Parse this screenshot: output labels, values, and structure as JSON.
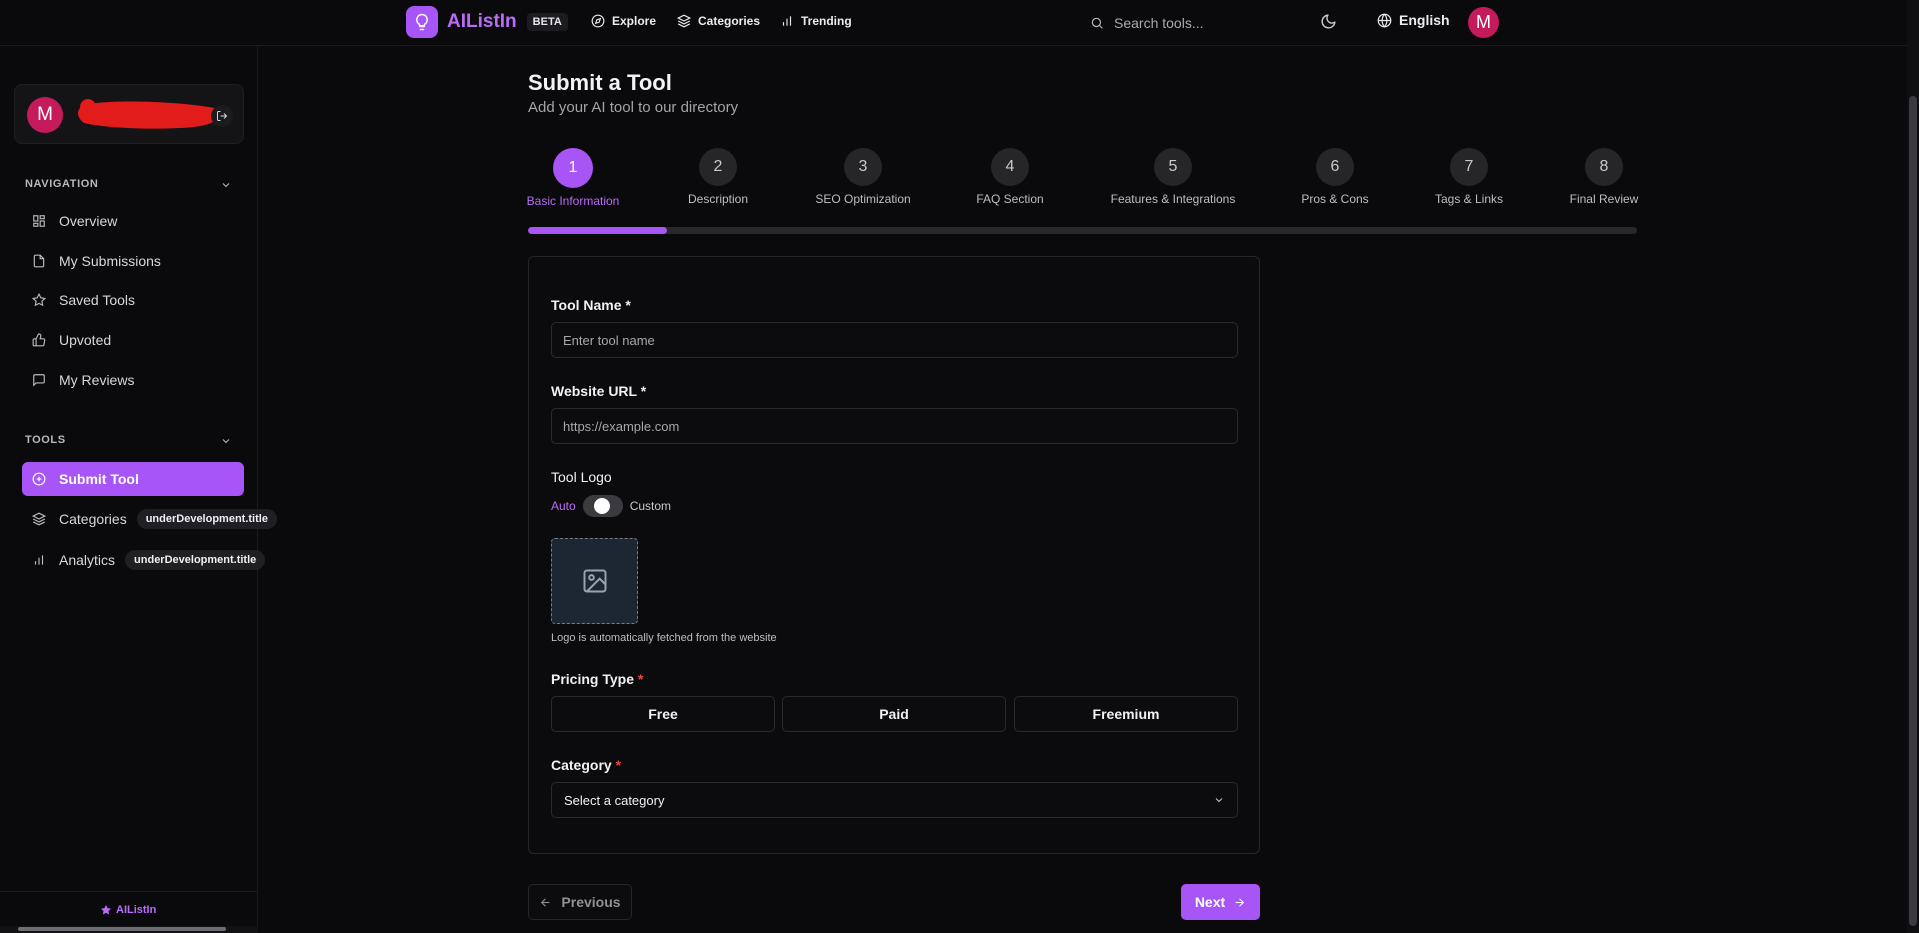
{
  "header": {
    "brand": "AIListIn",
    "beta": "BETA",
    "nav": [
      {
        "label": "Explore",
        "icon": "compass-icon"
      },
      {
        "label": "Categories",
        "icon": "layers-icon"
      },
      {
        "label": "Trending",
        "icon": "bar-chart-icon"
      }
    ],
    "search_placeholder": "Search tools...",
    "language": "English",
    "avatar_initial": "M"
  },
  "sidebar": {
    "user_initial": "M",
    "navigation_title": "NAVIGATION",
    "navigation_items": [
      {
        "label": "Overview",
        "icon": "grid-icon"
      },
      {
        "label": "My Submissions",
        "icon": "file-icon"
      },
      {
        "label": "Saved Tools",
        "icon": "star-icon"
      },
      {
        "label": "Upvoted",
        "icon": "thumbs-up-icon"
      },
      {
        "label": "My Reviews",
        "icon": "message-icon"
      }
    ],
    "tools_title": "TOOLS",
    "tools_items": [
      {
        "label": "Submit Tool",
        "icon": "plus-circle-icon",
        "active": true
      },
      {
        "label": "Categories",
        "icon": "layers-icon",
        "badge": "underDevelopment.title"
      },
      {
        "label": "Analytics",
        "icon": "bar-chart-icon",
        "badge": "underDevelopment.title"
      }
    ],
    "footer": "AIListIn"
  },
  "page": {
    "title": "Submit a Tool",
    "subtitle": "Add your AI tool to our directory"
  },
  "steps": [
    {
      "num": "1",
      "label": "Basic Information",
      "active": true
    },
    {
      "num": "2",
      "label": "Description"
    },
    {
      "num": "3",
      "label": "SEO Optimization"
    },
    {
      "num": "4",
      "label": "FAQ Section"
    },
    {
      "num": "5",
      "label": "Features & Integrations"
    },
    {
      "num": "6",
      "label": "Pros & Cons"
    },
    {
      "num": "7",
      "label": "Tags & Links"
    },
    {
      "num": "8",
      "label": "Final Review"
    }
  ],
  "progress_fraction": 0.125,
  "form": {
    "tool_name_label": "Tool Name",
    "tool_name_placeholder": "Enter tool name",
    "website_label": "Website URL",
    "website_placeholder": "https://example.com",
    "logo_label": "Tool Logo",
    "logo_toggle_left": "Auto",
    "logo_toggle_right": "Custom",
    "logo_help": "Logo is automatically fetched from the website",
    "pricing_label": "Pricing Type",
    "pricing_options": [
      "Free",
      "Paid",
      "Freemium"
    ],
    "category_label": "Category",
    "category_placeholder": "Select a category",
    "required_mark": "*"
  },
  "buttons": {
    "previous": "Previous",
    "next": "Next"
  },
  "colors": {
    "accent": "#a855f7",
    "avatar": "#c51a5b",
    "background": "#0a0a0c"
  }
}
